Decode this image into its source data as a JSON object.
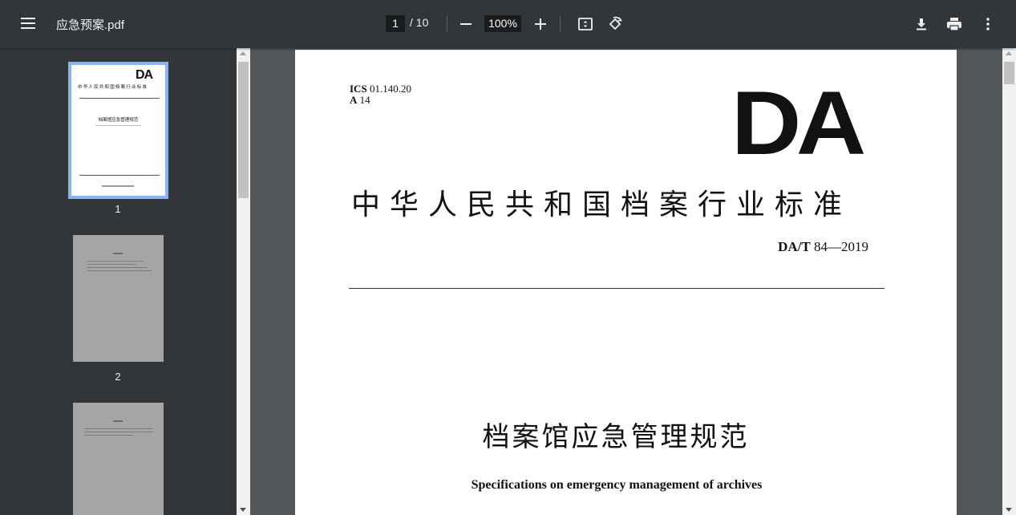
{
  "toolbar": {
    "menu_icon": "hamburger-menu-icon",
    "title": "应急预案.pdf",
    "current_page": "1",
    "total_pages": "/ 10",
    "zoom_out_icon": "minus-icon",
    "zoom_level": "100%",
    "zoom_in_icon": "plus-icon",
    "fit_icon": "fit-to-page-icon",
    "rotate_icon": "rotate-icon",
    "download_icon": "download-icon",
    "print_icon": "print-icon",
    "more_icon": "more-vert-icon"
  },
  "sidebar": {
    "thumbnails": [
      {
        "number": "1",
        "selected": true
      },
      {
        "number": "2",
        "selected": false
      },
      {
        "number": "",
        "selected": false
      }
    ],
    "thumb1": {
      "logo": "DA",
      "header": "中华人民共和国档案行业标准",
      "title": "档案馆应急管理规范"
    }
  },
  "document": {
    "ics_label": "ICS",
    "ics_code": "01.140.20",
    "class_label": "A",
    "class_code": "14",
    "logo": "DA",
    "standard_title": "中华人民共和国档案行业标准",
    "standard_prefix": "DA/T",
    "standard_number": "84—2019",
    "doc_title": "档案馆应急管理规范",
    "doc_subtitle": "Specifications on emergency management of archives"
  },
  "colors": {
    "toolbar_bg": "#323639",
    "viewer_bg": "#525659",
    "selected_border": "#8ab4f8"
  }
}
